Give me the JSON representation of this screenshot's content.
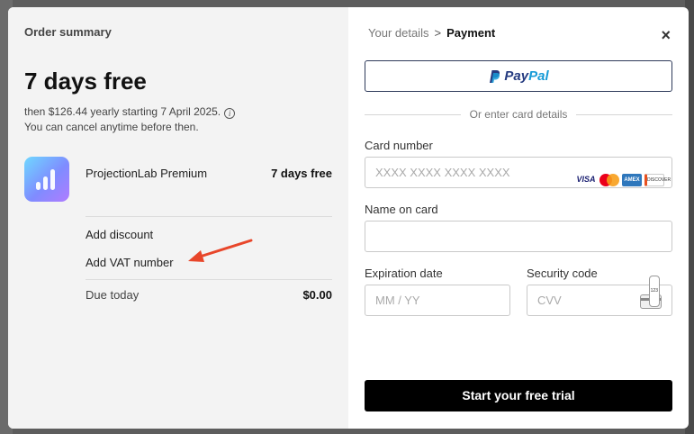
{
  "summary": {
    "title": "Order summary",
    "headline": "7 days free",
    "subline_1": "then $126.44 yearly starting 7 April 2025.",
    "subline_2": "You can cancel anytime before then.",
    "product": {
      "name": "ProjectionLab Premium",
      "price": "7 days free",
      "logo_icon": "bar-chart-icon"
    },
    "add_discount": "Add discount",
    "add_vat": "Add VAT number",
    "due_label": "Due today",
    "due_value": "$0.00"
  },
  "payment": {
    "breadcrumb": {
      "step1": "Your details",
      "separator": ">",
      "step2": "Payment"
    },
    "close_symbol": "×",
    "paypal": {
      "pay": "Pay",
      "pal": "Pal",
      "icon": "paypal-icon"
    },
    "or_text": "Or enter card details",
    "card_number": {
      "label": "Card number",
      "placeholder": "XXXX XXXX XXXX XXXX"
    },
    "name_on_card": {
      "label": "Name on card",
      "placeholder": ""
    },
    "expiration": {
      "label": "Expiration date",
      "placeholder": "MM / YY"
    },
    "security": {
      "label": "Security code",
      "placeholder": "CVV",
      "icon_text": "123"
    },
    "card_brands": {
      "visa": "VISA",
      "amex": "AMEX",
      "discover": "DISCOVER"
    },
    "submit": "Start your free trial"
  },
  "colors": {
    "accent_arrow": "#e8462a",
    "paypal_dark": "#253b80",
    "paypal_light": "#179bd7"
  }
}
